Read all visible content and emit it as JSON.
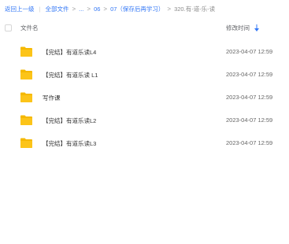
{
  "breadcrumb": {
    "back": "返回上一级",
    "all_files": "全部文件",
    "ellipsis": "...",
    "level1": "06",
    "level2": "07（保存后再学习）",
    "current": "320.有-道-乐-读",
    "link_color": "#3478f6"
  },
  "table": {
    "header_name": "文件名",
    "header_time": "修改时间",
    "sort_icon": "sort-descending-icon",
    "rows": [
      {
        "name": "【完结】有道乐读L4",
        "time": "2023-04-07 12:59",
        "icon": "folder-icon"
      },
      {
        "name": "【完结】有道乐读 L1",
        "time": "2023-04-07 12:59",
        "icon": "folder-icon"
      },
      {
        "name": "写作课",
        "time": "2023-04-07 12:59",
        "icon": "folder-icon"
      },
      {
        "name": "【完结】有道乐读L2",
        "time": "2023-04-07 12:59",
        "icon": "folder-icon"
      },
      {
        "name": "【完结】有道乐读L3",
        "time": "2023-04-07 12:59",
        "icon": "folder-icon"
      }
    ]
  },
  "colors": {
    "folder": "#fbc02d",
    "accent": "#3478f6"
  }
}
